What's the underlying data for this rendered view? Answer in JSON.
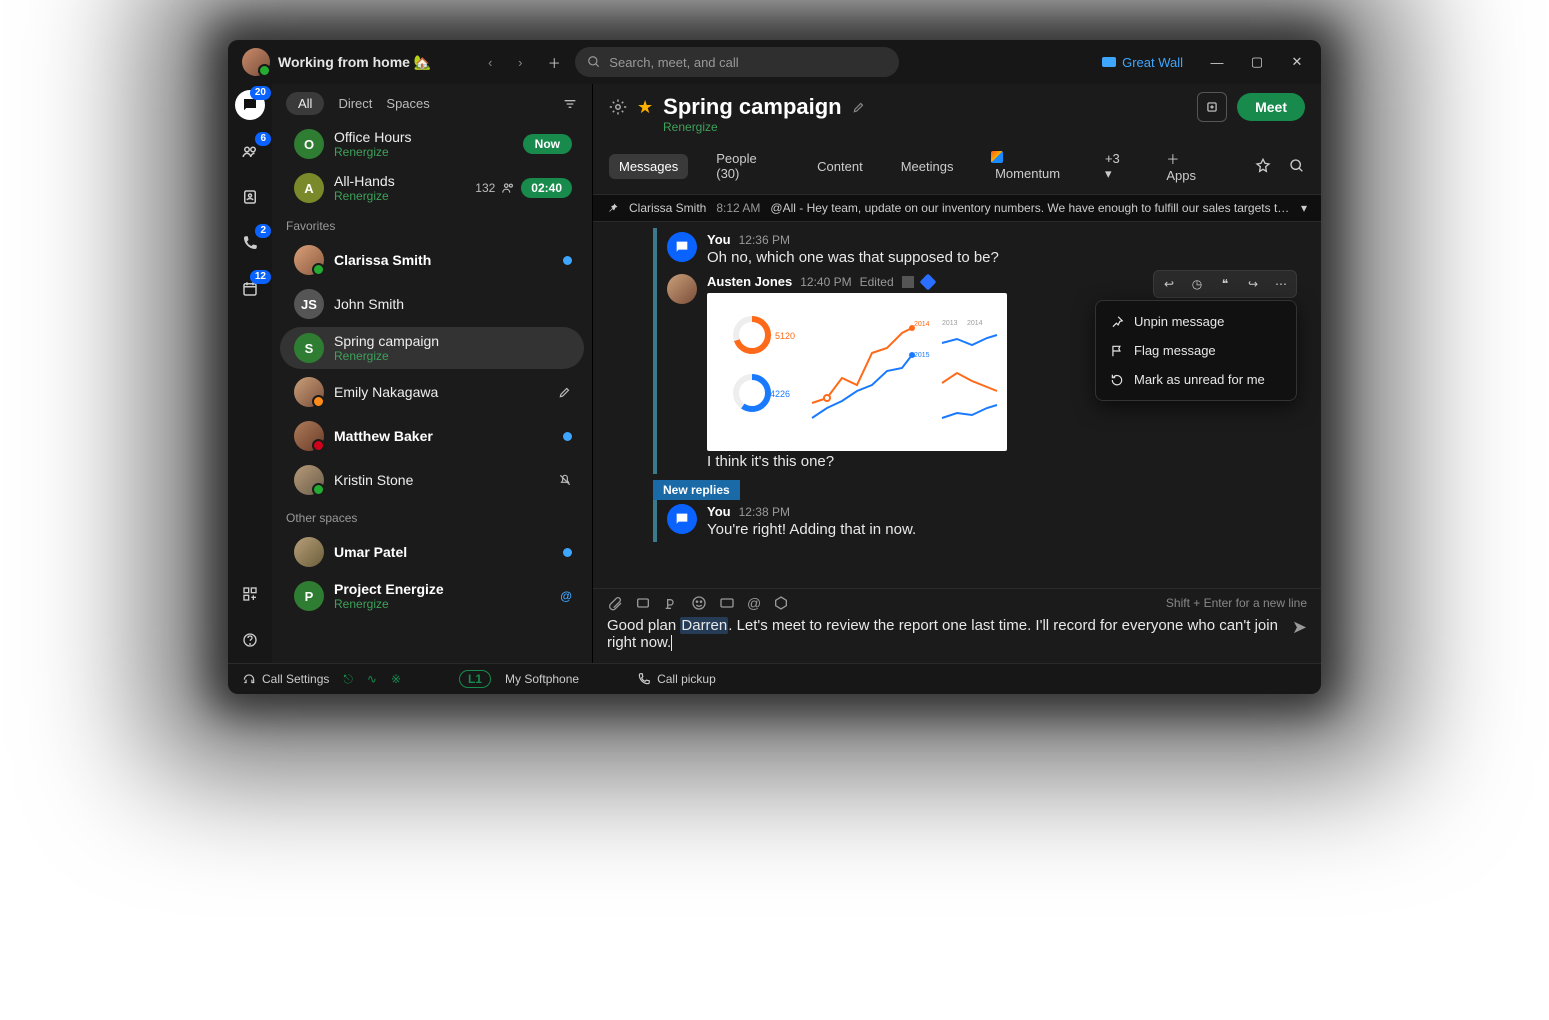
{
  "titlebar": {
    "status": "Working from home 🏡",
    "search_placeholder": "Search, meet, and call",
    "gw_label": "Great Wall"
  },
  "rail": {
    "chat_badge": "20",
    "teams_badge": "6",
    "phone_badge": "2",
    "cal_badge": "12"
  },
  "filters": {
    "all": "All",
    "direct": "Direct",
    "spaces": "Spaces"
  },
  "list": {
    "office": {
      "t": "Office Hours",
      "s": "Renergize",
      "now": "Now"
    },
    "allhands": {
      "t": "All-Hands",
      "s": "Renergize",
      "count": "132",
      "time": "02:40"
    },
    "fav_lbl": "Favorites",
    "clarissa": {
      "t": "Clarissa Smith"
    },
    "john": {
      "t": "John Smith"
    },
    "spring": {
      "t": "Spring campaign",
      "s": "Renergize"
    },
    "emily": {
      "t": "Emily Nakagawa"
    },
    "matt": {
      "t": "Matthew Baker"
    },
    "kristin": {
      "t": "Kristin Stone"
    },
    "other_lbl": "Other spaces",
    "umar": {
      "t": "Umar Patel"
    },
    "proj": {
      "t": "Project Energize",
      "s": "Renergize"
    }
  },
  "main": {
    "title": "Spring campaign",
    "sub": "Renergize",
    "meet": "Meet",
    "tabs": {
      "msg": "Messages",
      "ppl": "People (30)",
      "content": "Content",
      "meet": "Meetings",
      "mom": "Momentum",
      "more": "+3",
      "apps": "Apps"
    },
    "pin": {
      "name": "Clarissa Smith",
      "time": "8:12 AM",
      "text": "@All - Hey team, update on our inventory numbers. We have enough to fulfill our sales targets this mon…"
    }
  },
  "thread": {
    "m1": {
      "name": "You",
      "time": "12:36 PM",
      "body": "Oh no, which one was that supposed to be?"
    },
    "m2": {
      "name": "Austen Jones",
      "time": "12:40 PM",
      "edited": "Edited",
      "body": "I think it's this one?"
    },
    "new_replies": "New replies",
    "m3": {
      "name": "You",
      "time": "12:38 PM",
      "body": "You're right! Adding that in now."
    }
  },
  "ctx": {
    "unpin": "Unpin message",
    "flag": "Flag message",
    "unread": "Mark as unread for me"
  },
  "compose": {
    "hint": "Shift + Enter for a new line",
    "pre": "Good plan ",
    "mention": "Darren",
    "post": ". Let's meet to review the report one last time. I'll record for everyone who can't join right now."
  },
  "footer": {
    "cs": "Call Settings",
    "sp": "My Softphone",
    "cp": "Call pickup",
    "l1": "L1"
  },
  "chart_data": [
    {
      "type": "donut",
      "title": "5120",
      "color": "#ff6a1a",
      "percent": 70
    },
    {
      "type": "donut",
      "title": "4226",
      "color": "#1a7aff",
      "percent": 60
    },
    {
      "type": "line",
      "series": [
        {
          "name": "orange",
          "color": "#ff6a1a",
          "values": [
            20,
            22,
            35,
            30,
            55,
            60,
            72,
            78
          ]
        },
        {
          "name": "blue",
          "color": "#1a7aff",
          "values": [
            10,
            18,
            22,
            30,
            35,
            45,
            48,
            58
          ]
        }
      ],
      "x": [
        "",
        "",
        "",
        "",
        "",
        "",
        "",
        ""
      ],
      "ylim": [
        0,
        80
      ],
      "annot": [
        "2014",
        "2015"
      ]
    },
    {
      "type": "line",
      "series": [
        {
          "name": "blue",
          "color": "#1a7aff",
          "values": [
            48,
            52,
            46,
            55,
            58
          ]
        },
        {
          "name": "orange",
          "color": "#ff6a1a",
          "values": [
            30,
            40,
            32,
            28,
            25
          ]
        },
        {
          "name": "blue2",
          "color": "#1a7aff",
          "values": [
            12,
            16,
            14,
            20,
            22
          ]
        }
      ],
      "x": [
        "",
        "",
        "",
        "",
        ""
      ],
      "ylim": [
        0,
        60
      ],
      "annot": [
        "2013",
        "2014"
      ]
    }
  ]
}
